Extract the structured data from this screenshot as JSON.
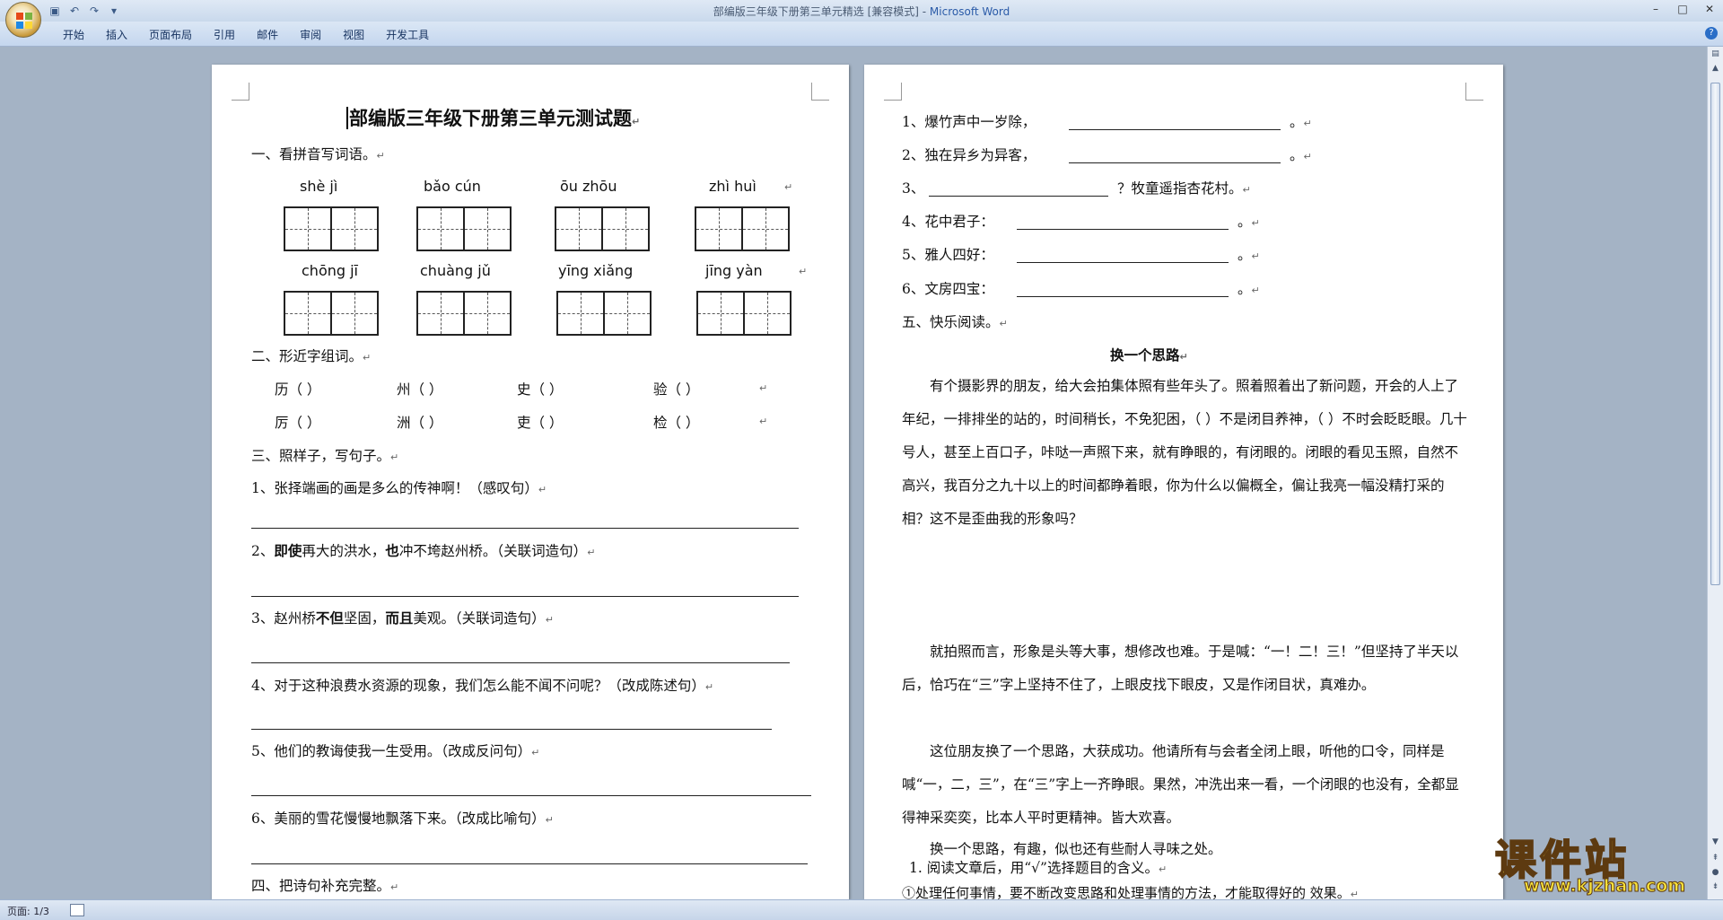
{
  "window": {
    "title": "部编版三年级下册第三单元精选 [兼容模式] - ",
    "app_name": "Microsoft Word"
  },
  "ribbon": {
    "tabs": [
      "开始",
      "插入",
      "页面布局",
      "引用",
      "邮件",
      "审阅",
      "视图",
      "开发工具"
    ]
  },
  "status": {
    "page": "页面: 1/3"
  },
  "page1": {
    "title": "部编版三年级下册第三单元测试题",
    "sec1": "一、看拼音写词语。",
    "pinyin_row1": [
      "shè  jì",
      "bǎo  cún",
      "ōu    zhōu",
      "zhì    huì"
    ],
    "pinyin_row2": [
      "chōng  jī",
      "chuàng  jǔ",
      "yīng  xiǎng",
      "jīng  yàn"
    ],
    "sec2": "二、形近字组词。",
    "groups_row1": [
      "历（      ）",
      "州（      ）",
      "史（        ）",
      "验（        ）"
    ],
    "groups_row2": [
      "厉（      ）",
      "洲（      ）",
      "吏（        ）",
      "检（        ）"
    ],
    "sec3": "三、照样子，写句子。",
    "q1": "1、张择端画的画是多么的传神啊！（感叹句）",
    "q2a": "2、",
    "q2b": "即使",
    "q2c": "再大的洪水，",
    "q2d": "也",
    "q2e": "冲不垮赵州桥。（关联词造句）",
    "q3a": "3、赵州桥",
    "q3b": "不但",
    "q3c": "坚固，",
    "q3d": "而且",
    "q3e": "美观。（关联词造句）",
    "q4": "4、对于这种浪费水资源的现象，我们怎么能不闻不问呢？（改成陈述句）",
    "q5": "5、他们的教诲使我一生受用。（改成反问句）",
    "q6": "6、美丽的雪花慢慢地飘落下来。（改成比喻句）",
    "sec4": "四、把诗句补充完整。"
  },
  "page2": {
    "p1": "1、爆竹声中一岁除，",
    "p2": "2、独在异乡为异客，",
    "p3_pre": "3、",
    "p3_post": "？牧童遥指杏花村。",
    "p4": "4、花中君子：",
    "p5": "5、雅人四好：",
    "p6": "6、文房四宝：",
    "period": "。",
    "sec5": "五、快乐阅读。",
    "story_title": "换一个思路",
    "para1": "有个摄影界的朋友，给大会拍集体照有些年头了。照着照着出了新问题，开会的人上了年纪，一排排坐的站的，时间稍长，不免犯困，（      ）不是闭目养神，（      ）不时会眨眨眼。几十号人，甚至上百口子，咔哒一声照下来，就有睁眼的，有闭眼的。闭眼的看见玉照，自然不高兴，我百分之九十以上的时间都睁着眼，你为什么以偏概全，偏让我亮一幅没精打采的相？这不是歪曲我的形象吗？",
    "para2": "就拍照而言，形象是头等大事，想修改也难。于是喊：“一！二！三！”但坚持了半天以后，恰巧在“三”字上坚持不住了，上眼皮找下眼皮，又是作闭目状，真难办。",
    "para3": "这位朋友换了一个思路，大获成功。他请所有与会者全闭上眼，听他的口令，同样是喊“一，二，三”，在“三”字上一齐睁眼。果然，冲洗出来一看，一个闭眼的也没有，全都显得神采奕奕，比本人平时更精神。皆大欢喜。",
    "para4": "换一个思路，有趣，似也还有些耐人寻味之处。",
    "q1": "1. 阅读文章后，用“√”选择题目的含义。",
    "q1opt": "①处理任何事情，要不断改变思路和处理事情的方法，才能取得好的 效果。"
  },
  "watermark": {
    "main": "课件站",
    "url": "www.kjzhan.com"
  }
}
